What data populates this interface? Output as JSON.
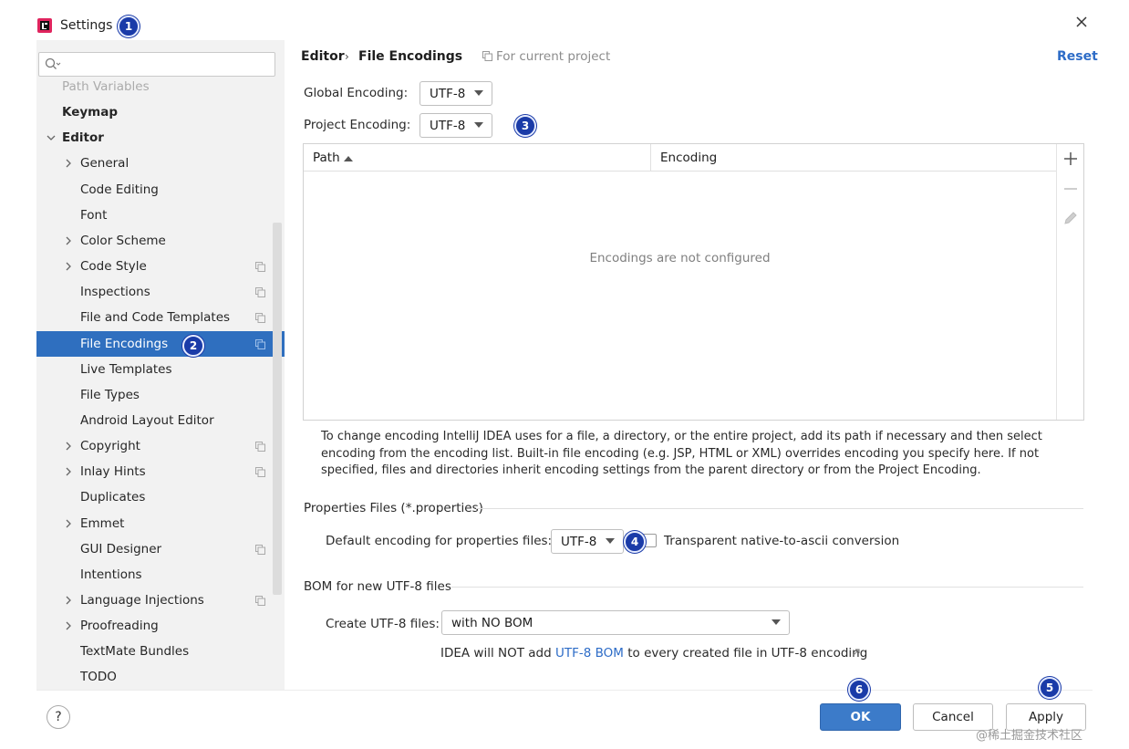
{
  "window": {
    "title": "Settings",
    "close_glyph": "×",
    "logo_icon": "intellij-idea-logo"
  },
  "markers": {
    "m1": "1",
    "m2": "2",
    "m3": "3",
    "m4": "4",
    "m5": "5",
    "m6": "6"
  },
  "sidebar": {
    "search": {
      "placeholder": "",
      "value": ""
    },
    "items": [
      {
        "label": "Path Variables",
        "expandable": false,
        "bold": false
      },
      {
        "label": "Keymap",
        "expandable": false,
        "bold": true
      },
      {
        "label": "Editor",
        "expandable": true,
        "expanded": true,
        "bold": true
      },
      {
        "label": "General",
        "expandable": true,
        "bold": false
      },
      {
        "label": "Code Editing",
        "expandable": false,
        "bold": false
      },
      {
        "label": "Font",
        "expandable": false,
        "bold": false
      },
      {
        "label": "Color Scheme",
        "expandable": true,
        "bold": false
      },
      {
        "label": "Code Style",
        "expandable": true,
        "bold": false,
        "project_scope": true
      },
      {
        "label": "Inspections",
        "expandable": false,
        "bold": false,
        "project_scope": true
      },
      {
        "label": "File and Code Templates",
        "expandable": false,
        "bold": false,
        "project_scope": true
      },
      {
        "label": "File Encodings",
        "expandable": false,
        "bold": false,
        "project_scope": true,
        "selected": true
      },
      {
        "label": "Live Templates",
        "expandable": false,
        "bold": false
      },
      {
        "label": "File Types",
        "expandable": false,
        "bold": false
      },
      {
        "label": "Android Layout Editor",
        "expandable": false,
        "bold": false
      },
      {
        "label": "Copyright",
        "expandable": true,
        "bold": false,
        "project_scope": true
      },
      {
        "label": "Inlay Hints",
        "expandable": true,
        "bold": false,
        "project_scope": true
      },
      {
        "label": "Duplicates",
        "expandable": false,
        "bold": false
      },
      {
        "label": "Emmet",
        "expandable": true,
        "bold": false
      },
      {
        "label": "GUI Designer",
        "expandable": false,
        "bold": false,
        "project_scope": true
      },
      {
        "label": "Intentions",
        "expandable": false,
        "bold": false
      },
      {
        "label": "Language Injections",
        "expandable": true,
        "bold": false,
        "project_scope": true
      },
      {
        "label": "Proofreading",
        "expandable": true,
        "bold": false
      },
      {
        "label": "TextMate Bundles",
        "expandable": false,
        "bold": false
      },
      {
        "label": "TODO",
        "expandable": false,
        "bold": false
      }
    ]
  },
  "header": {
    "breadcrumb_parent": "Editor",
    "breadcrumb_sep": "›",
    "breadcrumb_current": "File Encodings",
    "scope_label": "For current project",
    "reset_label": "Reset"
  },
  "encodings": {
    "global_label": "Global Encoding:",
    "global_value": "UTF-8",
    "project_label": "Project Encoding:",
    "project_value": "UTF-8"
  },
  "table": {
    "col_path": "Path",
    "col_encoding": "Encoding",
    "empty_message": "Encodings are not configured",
    "add_glyph": "+",
    "remove_glyph": "−"
  },
  "help_text": "To change encoding IntelliJ IDEA uses for a file, a directory, or the entire project, add its path if necessary and then select encoding from the encoding list. Built-in file encoding (e.g. JSP, HTML or XML) overrides encoding you specify here. If not specified, files and directories inherit encoding settings from the parent directory or from the Project Encoding.",
  "properties": {
    "section_title": "Properties Files (*.properties)",
    "default_label": "Default encoding for properties files:",
    "default_value": "UTF-8",
    "native_to_ascii_label": "Transparent native-to-ascii conversion",
    "native_to_ascii_checked": false
  },
  "bom": {
    "section_title": "BOM for new UTF-8 files",
    "create_label": "Create UTF-8 files:",
    "create_value": "with NO BOM",
    "note_before": "IDEA will NOT add ",
    "note_link": "UTF-8 BOM",
    "note_after": " to every created file in UTF-8 encoding"
  },
  "footer": {
    "help_glyph": "?",
    "ok_label": "OK",
    "cancel_label": "Cancel",
    "apply_label": "Apply"
  },
  "watermark": "@稀土掘金技术社区",
  "colors": {
    "selection": "#2f6fbf",
    "link": "#2d6cc7",
    "ok_button": "#3c7bc9",
    "marker": "#1a3ba8"
  }
}
